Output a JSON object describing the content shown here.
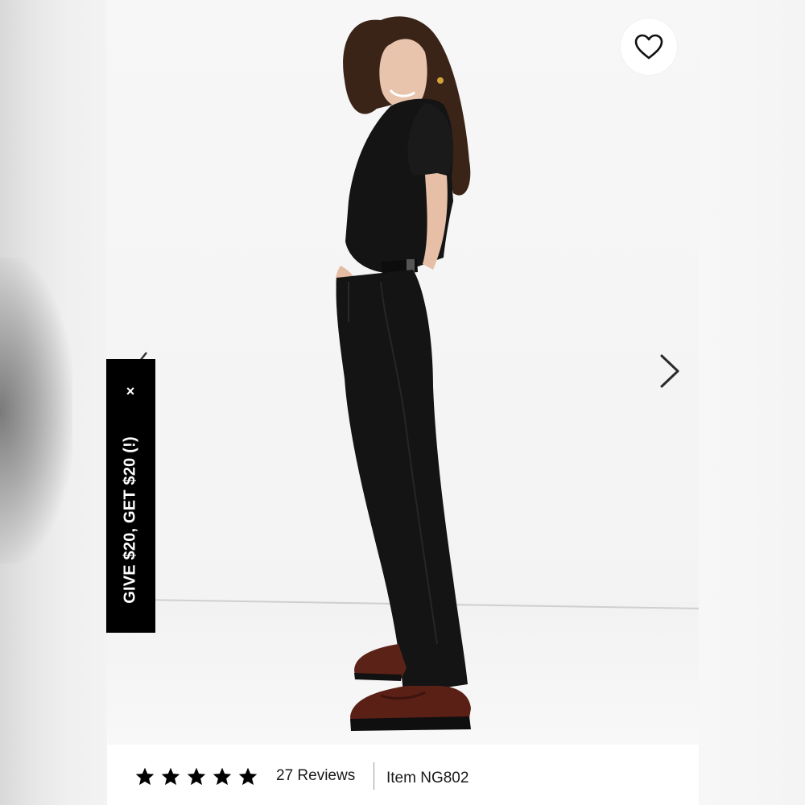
{
  "promo": {
    "label": "GIVE $20, GET $20 (!)",
    "close_symbol": "×"
  },
  "product_image": {
    "alt": "Model wearing black jeans and black tee with brown loafers"
  },
  "favorite": {
    "icon": "heart-outline-icon"
  },
  "carousel": {
    "next_icon": "chevron-right-icon",
    "prev_icon": "chevron-left-icon"
  },
  "rating": {
    "stars": 5,
    "star_color": "#000000",
    "reviews_label": "27 Reviews"
  },
  "item": {
    "label": "Item NG802"
  }
}
